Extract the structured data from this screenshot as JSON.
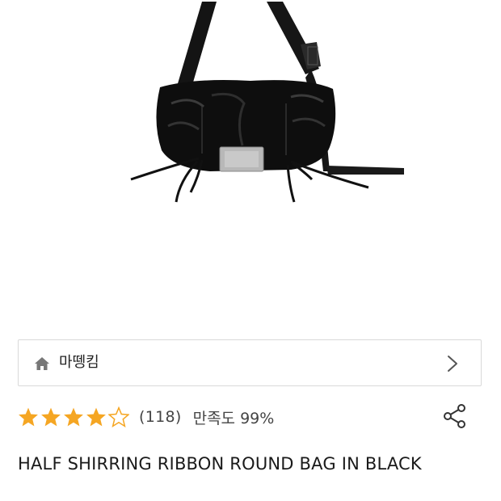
{
  "brand": {
    "name": "마뗑킴",
    "home_icon": "home-icon",
    "chevron_icon": "chevron-right-icon"
  },
  "rating": {
    "stars_filled": 4,
    "stars_total": 5,
    "review_count": "(118)",
    "satisfaction": "만족도 99%",
    "star_color": "#F5A623"
  },
  "share": {
    "icon": "share-icon"
  },
  "product": {
    "title": "HALF SHIRRING RIBBON ROUND BAG IN BLACK",
    "image_icon": "product-bag-image"
  }
}
